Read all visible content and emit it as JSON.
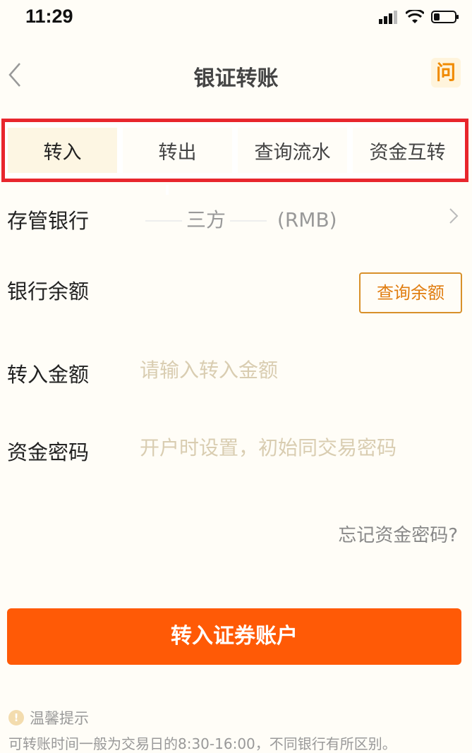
{
  "status_bar": {
    "time": "11:29"
  },
  "nav": {
    "title": "银证转账",
    "help_label": "问"
  },
  "tabs": [
    {
      "label": "转入",
      "active": true
    },
    {
      "label": "转出",
      "active": false
    },
    {
      "label": "查询流水",
      "active": false
    },
    {
      "label": "资金互转",
      "active": false
    }
  ],
  "form": {
    "bank_label": "存管银行",
    "bank_value_mid": "三方",
    "bank_currency": "(RMB)",
    "balance_label": "银行余额",
    "balance_button": "查询余额",
    "amount_label": "转入金额",
    "amount_placeholder": "请输入转入金额",
    "password_label": "资金密码",
    "password_placeholder": "开户时设置，初始同交易密码",
    "forgot_link": "忘记资金密码?"
  },
  "submit_label": "转入证券账户",
  "tips": {
    "title": "温馨提示",
    "text": "可转账时间一般为交易日的8:30-16:00，不同银行有所区别。"
  },
  "colors": {
    "accent": "#ff5a06",
    "highlight_border": "#e8262d",
    "help_bg": "#fff4dc"
  }
}
